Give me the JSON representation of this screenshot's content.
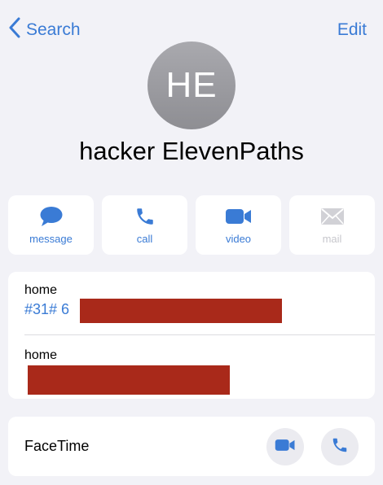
{
  "nav": {
    "back_label": "Search",
    "edit_label": "Edit"
  },
  "contact": {
    "initials": "HE",
    "name": "hacker ElevenPaths"
  },
  "actions": [
    {
      "label": "message",
      "icon": "message-bubble-icon",
      "enabled": true
    },
    {
      "label": "call",
      "icon": "phone-icon",
      "enabled": true
    },
    {
      "label": "video",
      "icon": "video-camera-icon",
      "enabled": true
    },
    {
      "label": "mail",
      "icon": "envelope-icon",
      "enabled": false
    }
  ],
  "phones": [
    {
      "label": "home",
      "value_visible": "#31# 6"
    },
    {
      "label": "home",
      "value_visible": ""
    }
  ],
  "facetime": {
    "label": "FaceTime"
  },
  "colors": {
    "accent": "#3a7bd5",
    "redaction": "#a9291a",
    "background": "#f2f2f7"
  }
}
